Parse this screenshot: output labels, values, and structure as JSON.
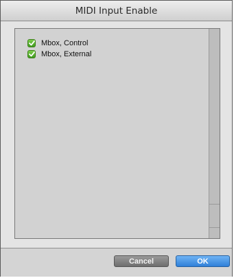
{
  "window": {
    "title": "MIDI Input Enable"
  },
  "device_list": {
    "items": [
      {
        "label": "Mbox, Control",
        "checked": true
      },
      {
        "label": "Mbox, External",
        "checked": true
      }
    ]
  },
  "footer": {
    "cancel_label": "Cancel",
    "ok_label": "OK"
  },
  "colors": {
    "checkbox_green": "#4caf26",
    "ok_button_blue": "#3a8ee6",
    "cancel_button_gray": "#808080"
  },
  "icons": {
    "checkbox": "checkmark-icon"
  }
}
